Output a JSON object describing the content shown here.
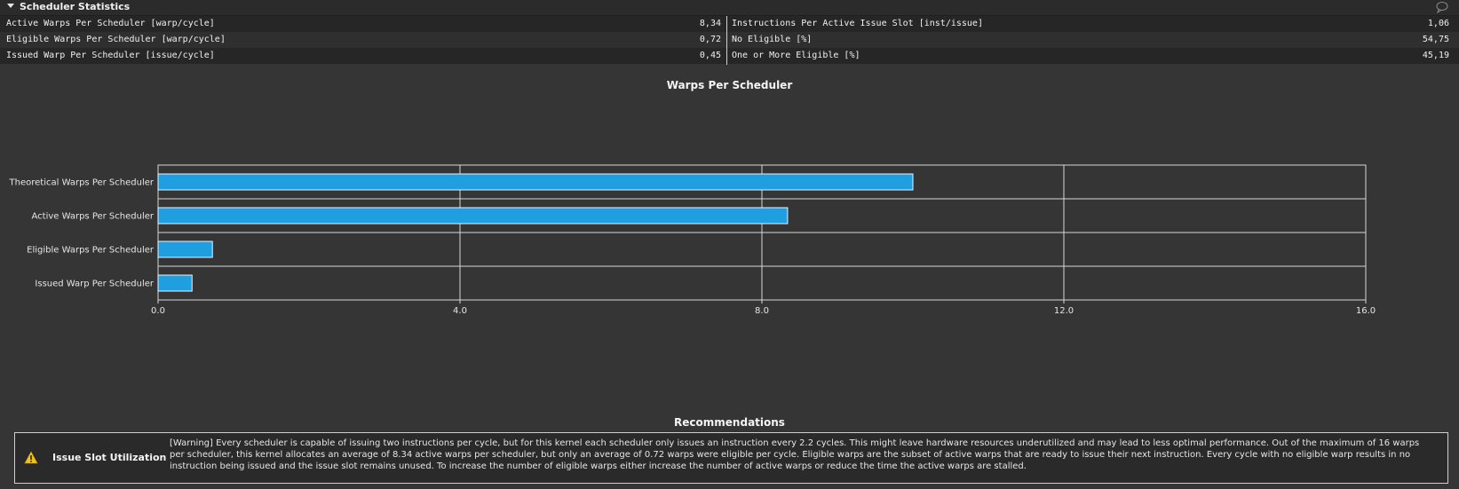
{
  "section": {
    "title": "Scheduler Statistics",
    "comment_icon": "speech-bubble-icon"
  },
  "stats": {
    "left": [
      {
        "label": "Active Warps Per Scheduler [warp/cycle]",
        "value": "8,34"
      },
      {
        "label": "Eligible Warps Per Scheduler [warp/cycle]",
        "value": "0,72"
      },
      {
        "label": "Issued Warp Per Scheduler [issue/cycle]",
        "value": "0,45"
      }
    ],
    "right": [
      {
        "label": "Instructions Per Active Issue Slot [inst/issue]",
        "value": "1,06"
      },
      {
        "label": "No Eligible [%]",
        "value": "54,75"
      },
      {
        "label": "One or More Eligible [%]",
        "value": "45,19"
      }
    ]
  },
  "chart_title": "Warps Per Scheduler",
  "chart_data": {
    "type": "bar",
    "orientation": "horizontal",
    "title": "Warps Per Scheduler",
    "categories": [
      "Theoretical Warps Per Scheduler",
      "Active Warps Per Scheduler",
      "Eligible Warps Per Scheduler",
      "Issued Warp Per Scheduler"
    ],
    "values": [
      10,
      8.34,
      0.72,
      0.45
    ],
    "xlim": [
      0,
      16
    ],
    "xticks": [
      "0.0",
      "4.0",
      "8.0",
      "12.0",
      "16.0"
    ],
    "tick_values": [
      0,
      4,
      8,
      12,
      16
    ],
    "grid": true,
    "bar_color": "#1f9fe0"
  },
  "recommendations": {
    "title": "Recommendations",
    "item": {
      "icon": "warning-icon",
      "name": "Issue Slot Utilization",
      "text": "[Warning] Every scheduler is capable of issuing two instructions per cycle, but for this kernel each scheduler only issues an instruction every 2.2 cycles. This might leave hardware resources underutilized and may lead to less optimal performance. Out of the maximum of 16 warps per scheduler, this kernel allocates an average of 8.34 active warps per scheduler, but only an average of 0.72 warps were eligible per cycle. Eligible warps are the subset of active warps that are ready to issue their next instruction. Every cycle with no eligible warp results in no instruction being issued and the issue slot remains unused. To increase the number of eligible warps either increase the number of active warps or reduce the time the active warps are stalled."
    }
  }
}
